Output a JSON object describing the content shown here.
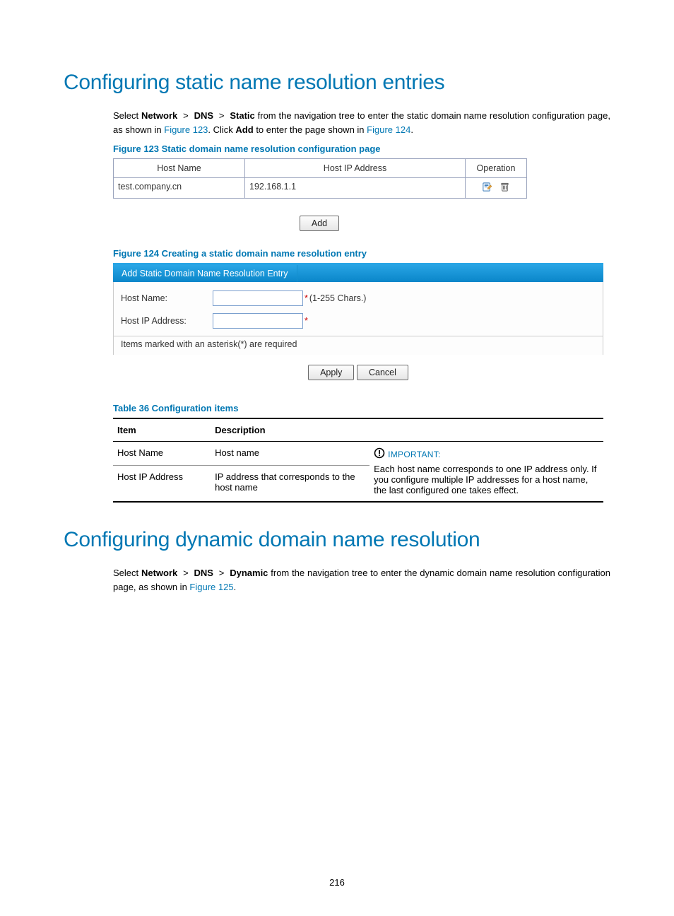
{
  "section1": {
    "title": "Configuring static name resolution entries",
    "para_select": "Select ",
    "nav_network": "Network",
    "gt": ">",
    "nav_dns": "DNS",
    "nav_static": "Static",
    "para_after_static": " from the navigation tree to enter the static domain name resolution configuration page, as shown in ",
    "link_fig123": "Figure 123",
    "para_click": ". Click ",
    "add_bold": "Add",
    "para_after_add": " to enter the page shown in ",
    "link_fig124": "Figure 124",
    "period": "."
  },
  "fig123": {
    "caption": "Figure 123 Static domain name resolution configuration page",
    "headers": {
      "host": "Host Name",
      "ip": "Host IP Address",
      "op": "Operation"
    },
    "row": {
      "host": "test.company.cn",
      "ip": "192.168.1.1"
    },
    "add_btn": "Add"
  },
  "fig124": {
    "caption": "Figure 124 Creating a static domain name resolution entry",
    "tab": "Add Static Domain Name Resolution Entry",
    "host_label": "Host Name:",
    "host_hint": "(1-255 Chars.)",
    "ip_label": "Host IP Address:",
    "asterisk": "*",
    "note": "Items marked with an asterisk(*) are required",
    "apply": "Apply",
    "cancel": "Cancel"
  },
  "table36": {
    "caption": "Table 36 Configuration items",
    "col_item": "Item",
    "col_desc": "Description",
    "row1_item": "Host Name",
    "row1_desc": "Host name",
    "row2_item": "Host IP Address",
    "row2_desc": "IP address that corresponds to the host name",
    "important_label": "IMPORTANT:",
    "important_text": "Each host name corresponds to one IP address only. If you configure multiple IP addresses for a host name, the last configured one takes effect."
  },
  "section2": {
    "title": "Configuring dynamic domain name resolution",
    "para_select": "Select ",
    "nav_network": "Network",
    "gt": ">",
    "nav_dns": "DNS",
    "nav_dynamic": "Dynamic",
    "para_after": " from the navigation tree to enter the dynamic domain name resolution configuration page, as shown in ",
    "link_fig125": "Figure 125",
    "period": "."
  },
  "page_number": "216"
}
